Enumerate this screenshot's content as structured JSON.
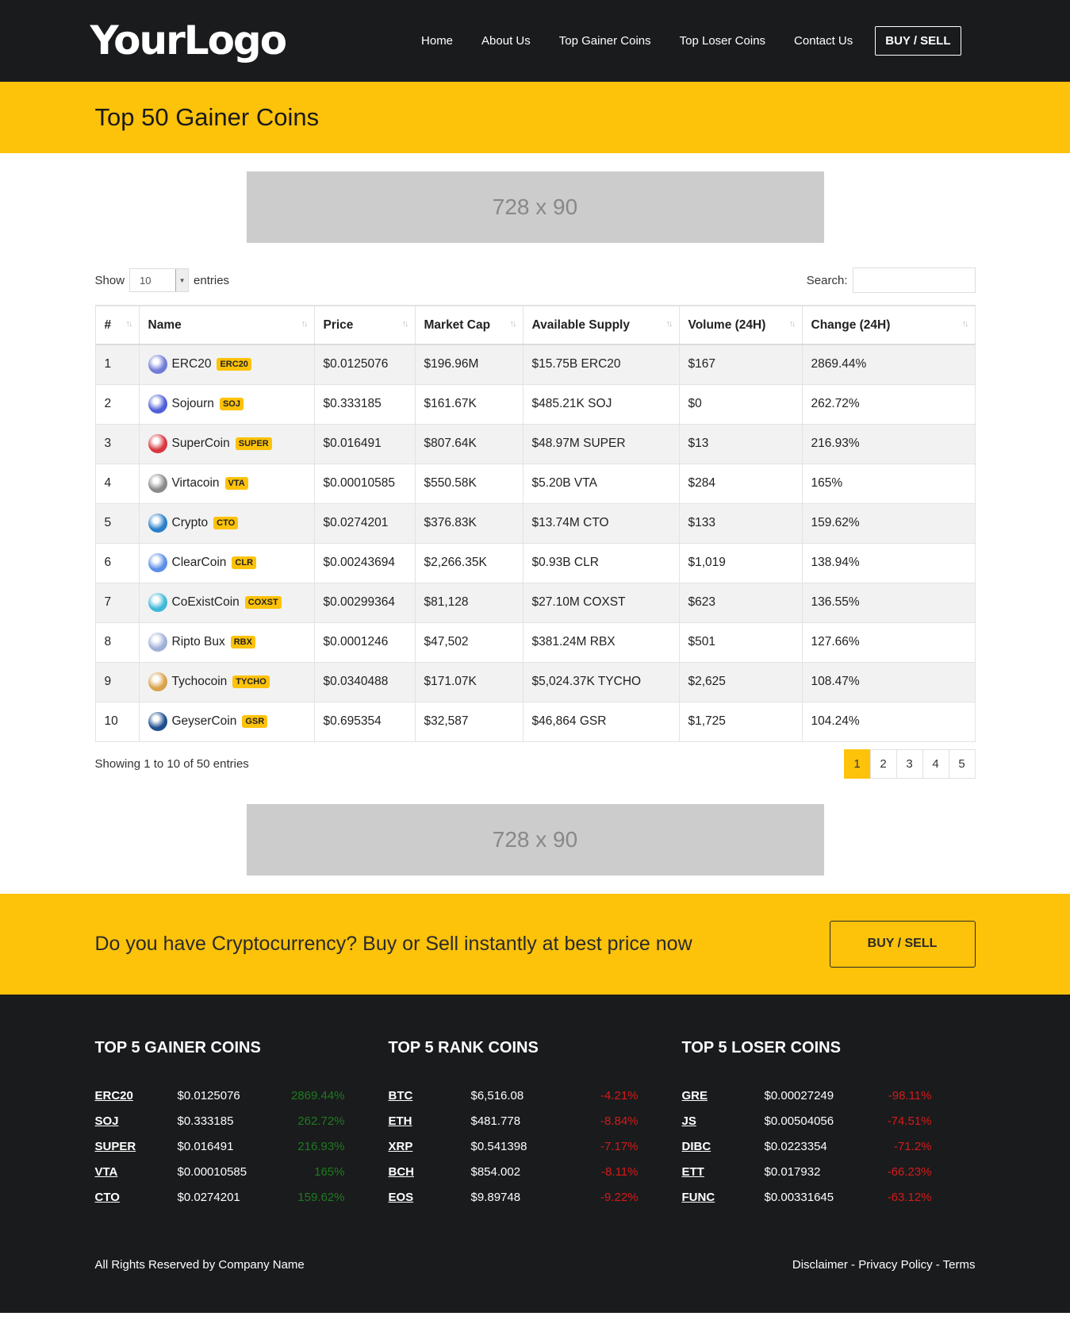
{
  "header": {
    "logo": "YourLogo",
    "nav": [
      "Home",
      "About Us",
      "Top Gainer Coins",
      "Top Loser Coins",
      "Contact Us"
    ],
    "buy_sell": "BUY / SELL"
  },
  "title_band": {
    "title": "Top 50 Gainer Coins"
  },
  "ads": {
    "top": "728 x 90",
    "bottom": "728 x 90"
  },
  "controls": {
    "show_label": "Show",
    "entries_value": "10",
    "entries_label": "entries",
    "search_label": "Search:",
    "search_value": ""
  },
  "table": {
    "columns": [
      "#",
      "Name",
      "Price",
      "Market Cap",
      "Available Supply",
      "Volume (24H)",
      "Change (24H)"
    ],
    "rows": [
      {
        "rank": "1",
        "name": "ERC20",
        "symbol": "ERC20",
        "icon": "erc20-icon",
        "icon_color": "#6f7bd6",
        "price": "$0.0125076",
        "market_cap": "$196.96M",
        "supply": "$15.75B ERC20",
        "volume": "$167",
        "change": "2869.44%"
      },
      {
        "rank": "2",
        "name": "Sojourn",
        "symbol": "SOJ",
        "icon": "sojourn-icon",
        "icon_color": "#4f5fd8",
        "price": "$0.333185",
        "market_cap": "$161.67K",
        "supply": "$485.21K SOJ",
        "volume": "$0",
        "change": "262.72%"
      },
      {
        "rank": "3",
        "name": "SuperCoin",
        "symbol": "SUPER",
        "icon": "supercoin-icon",
        "icon_color": "#d9363e",
        "price": "$0.016491",
        "market_cap": "$807.64K",
        "supply": "$48.97M SUPER",
        "volume": "$13",
        "change": "216.93%"
      },
      {
        "rank": "4",
        "name": "Virtacoin",
        "symbol": "VTA",
        "icon": "virtacoin-icon",
        "icon_color": "#8a8a8a",
        "price": "$0.00010585",
        "market_cap": "$550.58K",
        "supply": "$5.20B VTA",
        "volume": "$284",
        "change": "165%"
      },
      {
        "rank": "5",
        "name": "Crypto",
        "symbol": "CTO",
        "icon": "crypto-icon",
        "icon_color": "#2a7fc9",
        "price": "$0.0274201",
        "market_cap": "$376.83K",
        "supply": "$13.74M CTO",
        "volume": "$133",
        "change": "159.62%"
      },
      {
        "rank": "6",
        "name": "ClearCoin",
        "symbol": "CLR",
        "icon": "clearcoin-icon",
        "icon_color": "#5b8ee6",
        "price": "$0.00243694",
        "market_cap": "$2,266.35K",
        "supply": "$0.93B CLR",
        "volume": "$1,019",
        "change": "138.94%"
      },
      {
        "rank": "7",
        "name": "CoExistCoin",
        "symbol": "COXST",
        "icon": "coexistcoin-icon",
        "icon_color": "#3fb8d8",
        "price": "$0.00299364",
        "market_cap": "$81,128",
        "supply": "$27.10M COXST",
        "volume": "$623",
        "change": "136.55%"
      },
      {
        "rank": "8",
        "name": "Ripto Bux",
        "symbol": "RBX",
        "icon": "riptobux-icon",
        "icon_color": "#9fb0d8",
        "price": "$0.0001246",
        "market_cap": "$47,502",
        "supply": "$381.24M RBX",
        "volume": "$501",
        "change": "127.66%"
      },
      {
        "rank": "9",
        "name": "Tychocoin",
        "symbol": "TYCHO",
        "icon": "tychocoin-icon",
        "icon_color": "#d9a24a",
        "price": "$0.0340488",
        "market_cap": "$171.07K",
        "supply": "$5,024.37K TYCHO",
        "volume": "$2,625",
        "change": "108.47%"
      },
      {
        "rank": "10",
        "name": "GeyserCoin",
        "symbol": "GSR",
        "icon": "geysercoin-icon",
        "icon_color": "#1f4f8f",
        "price": "$0.695354",
        "market_cap": "$32,587",
        "supply": "$46,864 GSR",
        "volume": "$1,725",
        "change": "104.24%"
      }
    ],
    "info": "Showing 1 to 10 of 50 entries",
    "pages": [
      "1",
      "2",
      "3",
      "4",
      "5"
    ],
    "current_page": "1"
  },
  "cta": {
    "text": "Do you have Cryptocurrency? Buy or Sell instantly at best price now",
    "button": "BUY / SELL"
  },
  "footer": {
    "columns": [
      {
        "title": "TOP 5 GAINER COINS",
        "direction": "up",
        "rows": [
          {
            "symbol": "ERC20",
            "price": "$0.0125076",
            "change": "2869.44%"
          },
          {
            "symbol": "SOJ",
            "price": "$0.333185",
            "change": "262.72%"
          },
          {
            "symbol": "SUPER",
            "price": "$0.016491",
            "change": "216.93%"
          },
          {
            "symbol": "VTA",
            "price": "$0.00010585",
            "change": "165%"
          },
          {
            "symbol": "CTO",
            "price": "$0.0274201",
            "change": "159.62%"
          }
        ]
      },
      {
        "title": "TOP 5 RANK COINS",
        "direction": "down",
        "rows": [
          {
            "symbol": "BTC",
            "price": "$6,516.08",
            "change": "-4.21%"
          },
          {
            "symbol": "ETH",
            "price": "$481.778",
            "change": "-8.84%"
          },
          {
            "symbol": "XRP",
            "price": "$0.541398",
            "change": "-7.17%"
          },
          {
            "symbol": "BCH",
            "price": "$854.002",
            "change": "-8.11%"
          },
          {
            "symbol": "EOS",
            "price": "$9.89748",
            "change": "-9.22%"
          }
        ]
      },
      {
        "title": "TOP 5 LOSER COINS",
        "direction": "down",
        "rows": [
          {
            "symbol": "GRE",
            "price": "$0.00027249",
            "change": "-98.11%"
          },
          {
            "symbol": "JS",
            "price": "$0.00504056",
            "change": "-74.51%"
          },
          {
            "symbol": "DIBC",
            "price": "$0.0223354",
            "change": "-71.2%"
          },
          {
            "symbol": "ETT",
            "price": "$0.017932",
            "change": "-66.23%"
          },
          {
            "symbol": "FUNC",
            "price": "$0.00331645",
            "change": "-63.12%"
          }
        ]
      }
    ],
    "copyright": "All Rights Reserved by Company Name",
    "links": [
      "Disclaimer",
      "Privacy Policy",
      "Terms"
    ],
    "link_separator": " - "
  },
  "colors": {
    "accent": "#fdc20a",
    "dark": "#1a1b1d",
    "gain": "#1e8b1e",
    "loss": "#d51a1a"
  }
}
